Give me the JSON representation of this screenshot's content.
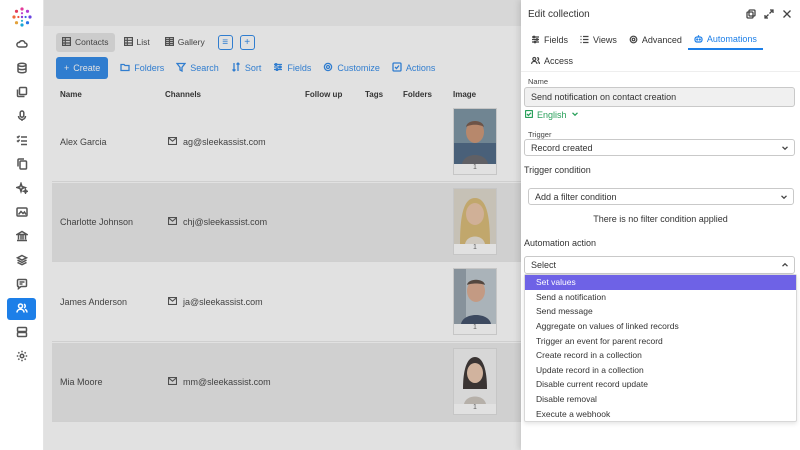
{
  "rail": {
    "items": [
      {
        "icon": "cloud-icon"
      },
      {
        "icon": "database-icon"
      },
      {
        "icon": "pages-icon"
      },
      {
        "icon": "microphone-icon"
      },
      {
        "icon": "checklist-icon"
      },
      {
        "icon": "copy-icon"
      },
      {
        "icon": "sparkles-icon"
      },
      {
        "icon": "image-chart-icon"
      },
      {
        "icon": "bank-icon"
      },
      {
        "icon": "layers-icon"
      },
      {
        "icon": "chat-icon"
      },
      {
        "icon": "users-icon"
      },
      {
        "icon": "server-icon"
      },
      {
        "icon": "gear-icon"
      }
    ],
    "active_index": 11
  },
  "main": {
    "view_tabs": [
      {
        "label": "Contacts",
        "icon": "table-icon",
        "selected": true
      },
      {
        "label": "List",
        "icon": "list-icon",
        "selected": false
      },
      {
        "label": "Gallery",
        "icon": "gallery-icon",
        "selected": false
      }
    ],
    "toolbar": {
      "create": "Create",
      "folders": "Folders",
      "search": "Search",
      "sort": "Sort",
      "fields": "Fields",
      "customize": "Customize",
      "actions": "Actions"
    },
    "columns": {
      "name": "Name",
      "channels": "Channels",
      "follow_up": "Follow up",
      "tags": "Tags",
      "folders": "Folders",
      "image": "Image"
    },
    "rows": [
      {
        "name": "Alex Garcia",
        "email": "ag@sleekassist.com",
        "image_count": "1"
      },
      {
        "name": "Charlotte Johnson",
        "email": "chj@sleekassist.com",
        "image_count": "1"
      },
      {
        "name": "James Anderson",
        "email": "ja@sleekassist.com",
        "image_count": "1"
      },
      {
        "name": "Mia Moore",
        "email": "mm@sleekassist.com",
        "image_count": "1"
      }
    ]
  },
  "side": {
    "title": "Edit collection",
    "tabs": [
      {
        "label": "Fields",
        "icon": "sliders-icon",
        "selected": false
      },
      {
        "label": "Views",
        "icon": "list-icon",
        "selected": false
      },
      {
        "label": "Advanced",
        "icon": "gear-icon",
        "selected": false
      },
      {
        "label": "Automations",
        "icon": "robot-icon",
        "selected": true
      }
    ],
    "access_tab": "Access",
    "name_label": "Name",
    "name_value": "Send notification on contact creation",
    "language": "English",
    "trigger_label": "Trigger",
    "trigger_value": "Record created",
    "trigger_condition_label": "Trigger condition",
    "filter_placeholder": "Add a filter condition",
    "filter_empty": "There is no filter condition applied",
    "automation_action_label": "Automation action",
    "action_select_value": "Select",
    "action_options": [
      "Set values",
      "Send a notification",
      "Send message",
      "Aggregate on values of linked records",
      "Trigger an event for parent record",
      "Create record in a collection",
      "Update record in a collection",
      "Disable current record update",
      "Disable removal",
      "Execute a webhook"
    ],
    "highlighted_option": 0,
    "accent_color": "#1d7fe8",
    "highlight_color": "#6e62e6",
    "language_color": "#29a05a"
  }
}
